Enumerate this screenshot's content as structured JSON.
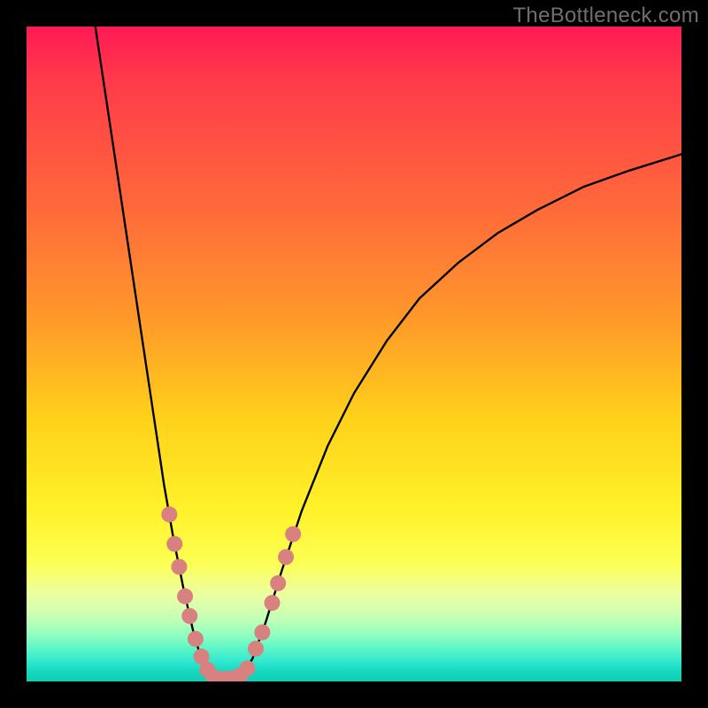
{
  "watermark": "TheBottleneck.com",
  "colors": {
    "frame": "#000000",
    "curve": "#000000",
    "points_fill": "#d98080",
    "points_stroke": "#b05a5a",
    "gradient_top": "#ff1a55",
    "gradient_bottom": "#0ecfb0"
  },
  "chart_data": {
    "type": "line",
    "title": "",
    "xlabel": "",
    "ylabel": "",
    "xlim": [
      0,
      100
    ],
    "ylim": [
      0,
      100
    ],
    "grid": false,
    "curves": [
      {
        "name": "left-valley-branch",
        "note": "steep descending curve from top to valley floor",
        "points": [
          {
            "x": 10.5,
            "y": 100
          },
          {
            "x": 12.0,
            "y": 90
          },
          {
            "x": 13.5,
            "y": 80
          },
          {
            "x": 15.0,
            "y": 70
          },
          {
            "x": 16.5,
            "y": 60
          },
          {
            "x": 18.0,
            "y": 50
          },
          {
            "x": 19.5,
            "y": 40
          },
          {
            "x": 21.0,
            "y": 30
          },
          {
            "x": 22.4,
            "y": 22
          },
          {
            "x": 24.0,
            "y": 14
          },
          {
            "x": 25.6,
            "y": 7
          },
          {
            "x": 27.0,
            "y": 2.5
          },
          {
            "x": 28.5,
            "y": 0.5
          }
        ]
      },
      {
        "name": "valley-floor",
        "note": "minimum plateau near x≈28–32",
        "points": [
          {
            "x": 28.5,
            "y": 0.5
          },
          {
            "x": 30.0,
            "y": 0.3
          },
          {
            "x": 31.5,
            "y": 0.4
          },
          {
            "x": 33.0,
            "y": 1.0
          }
        ]
      },
      {
        "name": "right-valley-branch",
        "note": "rising curve with decreasing slope toward right edge",
        "points": [
          {
            "x": 33.0,
            "y": 1.0
          },
          {
            "x": 34.5,
            "y": 3.5
          },
          {
            "x": 36.5,
            "y": 9
          },
          {
            "x": 39.0,
            "y": 17
          },
          {
            "x": 42.0,
            "y": 26
          },
          {
            "x": 46.0,
            "y": 36
          },
          {
            "x": 50.0,
            "y": 44
          },
          {
            "x": 55.0,
            "y": 52
          },
          {
            "x": 60.0,
            "y": 58.5
          },
          {
            "x": 66.0,
            "y": 64
          },
          {
            "x": 72.0,
            "y": 68.5
          },
          {
            "x": 78.0,
            "y": 72
          },
          {
            "x": 85.0,
            "y": 75.5
          },
          {
            "x": 92.0,
            "y": 78
          },
          {
            "x": 100.0,
            "y": 80.5
          }
        ]
      }
    ],
    "scatter": {
      "name": "highlight-dots",
      "note": "pink dots clustered on both branches near valley and along valley floor",
      "points": [
        {
          "x": 21.8,
          "y": 25.5
        },
        {
          "x": 22.6,
          "y": 21.0
        },
        {
          "x": 23.3,
          "y": 17.5
        },
        {
          "x": 24.2,
          "y": 13.0
        },
        {
          "x": 24.9,
          "y": 10.0
        },
        {
          "x": 25.8,
          "y": 6.5
        },
        {
          "x": 26.7,
          "y": 3.8
        },
        {
          "x": 27.6,
          "y": 1.8
        },
        {
          "x": 28.6,
          "y": 0.6
        },
        {
          "x": 29.6,
          "y": 0.4
        },
        {
          "x": 30.6,
          "y": 0.4
        },
        {
          "x": 31.6,
          "y": 0.5
        },
        {
          "x": 32.6,
          "y": 0.9
        },
        {
          "x": 33.7,
          "y": 2.0
        },
        {
          "x": 35.0,
          "y": 5.0
        },
        {
          "x": 36.0,
          "y": 7.5
        },
        {
          "x": 37.5,
          "y": 12.0
        },
        {
          "x": 38.4,
          "y": 15.0
        },
        {
          "x": 39.6,
          "y": 19.0
        },
        {
          "x": 40.7,
          "y": 22.5
        }
      ]
    }
  }
}
